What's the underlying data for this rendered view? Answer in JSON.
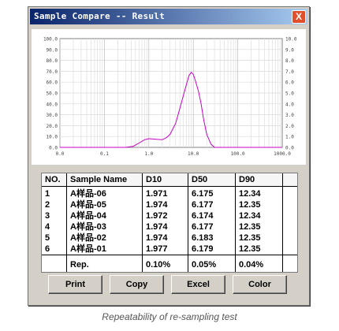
{
  "window": {
    "title": "Sample Compare -- Result",
    "close_label": "X"
  },
  "chart_data": {
    "type": "line",
    "x_scale": "log",
    "xlim": [
      0.01,
      1000
    ],
    "ylim": [
      0,
      100
    ],
    "x_tick_labels": [
      "0.0",
      "0.1",
      "1.0",
      "10.0",
      "100.0",
      "1000.0"
    ],
    "y_tick_labels_left": [
      "0.0",
      "10.0",
      "20.0",
      "30.0",
      "40.0",
      "50.0",
      "60.0",
      "70.0",
      "80.0",
      "90.0",
      "100.0"
    ],
    "y_tick_labels_right": [
      "0.0",
      "1.0",
      "2.0",
      "3.0",
      "4.0",
      "5.0",
      "6.0",
      "7.0",
      "8.0",
      "9.0",
      "10.0"
    ],
    "series": [
      {
        "color": "#c800c8",
        "x": [
          0.01,
          0.3,
          0.45,
          0.6,
          0.8,
          1.0,
          1.5,
          2.0,
          2.5,
          3.0,
          4.0,
          5.0,
          6.0,
          7.0,
          8.0,
          9.0,
          10.0,
          11.0,
          13.0,
          15.0,
          17.0,
          20.0,
          25.0,
          30.0,
          1000
        ],
        "y": [
          0,
          0,
          1,
          4,
          7,
          8,
          7.5,
          7,
          9,
          12,
          22,
          36,
          48,
          58,
          66,
          69,
          67,
          62,
          52,
          40,
          26,
          12,
          3,
          0,
          0
        ]
      }
    ]
  },
  "table": {
    "headers": [
      "NO.",
      "Sample Name",
      "D10",
      "D50",
      "D90"
    ],
    "rows": [
      [
        "1",
        "A样品-06",
        "1.971",
        "6.175",
        "12.34"
      ],
      [
        "2",
        "A样品-05",
        "1.974",
        "6.177",
        "12.35"
      ],
      [
        "3",
        "A样品-04",
        "1.972",
        "6.174",
        "12.34"
      ],
      [
        "4",
        "A样品-03",
        "1.974",
        "6.177",
        "12.35"
      ],
      [
        "5",
        "A样品-02",
        "1.974",
        "6.183",
        "12.35"
      ],
      [
        "6",
        "A样品-01",
        "1.977",
        "6.179",
        "12.35"
      ]
    ],
    "rep": [
      "",
      "Rep.",
      "0.10%",
      "0.05%",
      "0.04%"
    ]
  },
  "buttons": {
    "print": "Print",
    "copy": "Copy",
    "excel": "Excel",
    "color": "Color"
  },
  "caption": "Repeatability of re-sampling test"
}
